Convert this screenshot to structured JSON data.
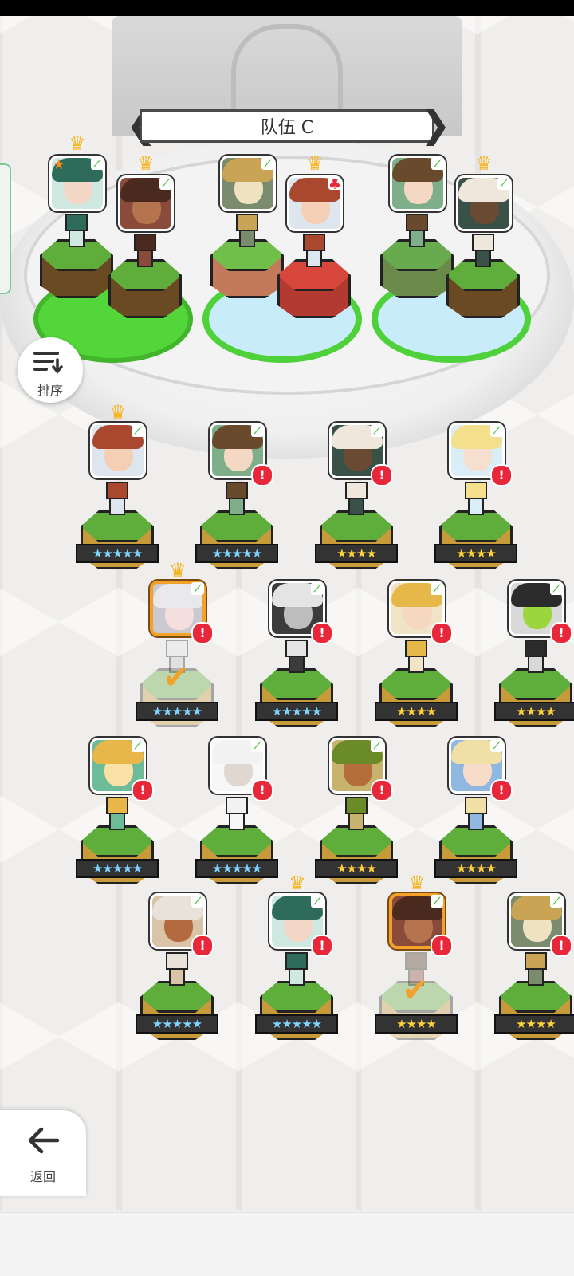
{
  "team": {
    "name": "队伍 C"
  },
  "buttons": {
    "sort_label": "排序",
    "back_label": "返回"
  },
  "team_slots": [
    {
      "pair": 1,
      "members": [
        {
          "crown": true,
          "favorite": true,
          "portrait": "green-hair-woman"
        },
        {
          "crown": true,
          "favorite": false,
          "portrait": "brown-hair-man"
        }
      ]
    },
    {
      "pair": 2,
      "members": [
        {
          "crown": false,
          "favorite": false,
          "portrait": "owl-hero"
        },
        {
          "crown": true,
          "favorite": false,
          "portrait": "red-hair-boy"
        }
      ]
    },
    {
      "pair": 3,
      "members": [
        {
          "crown": false,
          "favorite": false,
          "portrait": "headband-girl"
        },
        {
          "crown": true,
          "favorite": false,
          "portrait": "white-hair-dark-skin"
        }
      ]
    }
  ],
  "roster": [
    {
      "stars": "★★★★★",
      "rarity": 5,
      "crown": true,
      "alert": false,
      "selected": false
    },
    {
      "stars": "★★★★★",
      "rarity": 5,
      "crown": false,
      "alert": true,
      "selected": false
    },
    {
      "stars": "★★★★",
      "rarity": 4,
      "crown": false,
      "alert": true,
      "selected": false
    },
    {
      "stars": "★★★★",
      "rarity": 4,
      "crown": false,
      "alert": true,
      "selected": false
    },
    {
      "stars": "★★★★★",
      "rarity": 5,
      "crown": true,
      "alert": true,
      "selected": true
    },
    {
      "stars": "★★★★★",
      "rarity": 5,
      "crown": false,
      "alert": true,
      "selected": false
    },
    {
      "stars": "★★★★",
      "rarity": 4,
      "crown": false,
      "alert": true,
      "selected": false
    },
    {
      "stars": "★★★★",
      "rarity": 4,
      "crown": false,
      "alert": true,
      "selected": false
    },
    {
      "stars": "★★★★★",
      "rarity": 5,
      "crown": false,
      "alert": true,
      "selected": false
    },
    {
      "stars": "★★★★★",
      "rarity": 5,
      "crown": false,
      "alert": true,
      "selected": false
    },
    {
      "stars": "★★★★",
      "rarity": 4,
      "crown": false,
      "alert": true,
      "selected": false
    },
    {
      "stars": "★★★★",
      "rarity": 4,
      "crown": false,
      "alert": true,
      "selected": false
    },
    {
      "stars": "★★★★★",
      "rarity": 5,
      "crown": false,
      "alert": true,
      "selected": false
    },
    {
      "stars": "★★★★★",
      "rarity": 5,
      "crown": true,
      "alert": true,
      "selected": false
    },
    {
      "stars": "★★★★",
      "rarity": 4,
      "crown": true,
      "alert": true,
      "selected": true
    },
    {
      "stars": "★★★★",
      "rarity": 4,
      "crown": false,
      "alert": true,
      "selected": false
    }
  ],
  "colors": {
    "crown": "#f6b625",
    "alert": "#e8283a",
    "selected_border": "#f2a22b",
    "leaf": "#3fc23a",
    "ring_green": "#53d63a",
    "ring_blue": "#c9ecfa"
  },
  "icons": {
    "sort": "sort-descending-icon",
    "back": "arrow-left-icon",
    "leaf": "leaf-icon",
    "crown": "crown-icon",
    "alert": "exclamation-icon",
    "check": "checkmark-icon",
    "prev": "chevron-left-icon",
    "next": "chevron-right-icon"
  }
}
